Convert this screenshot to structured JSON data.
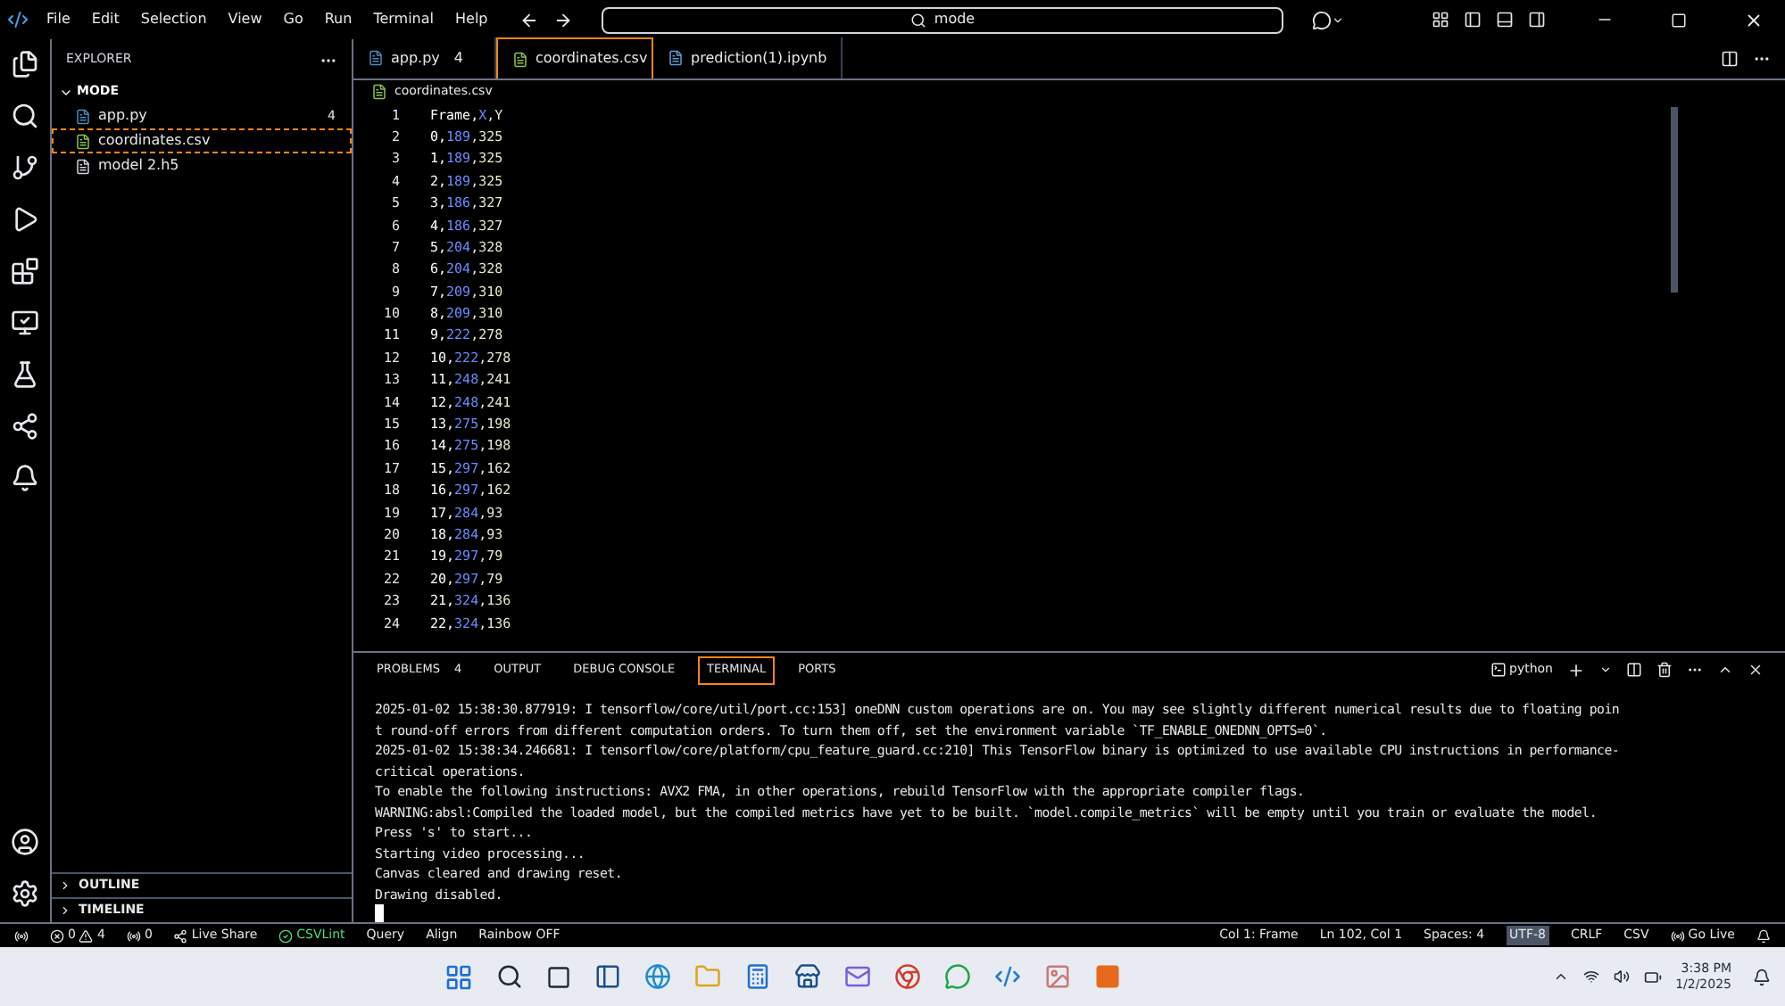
{
  "menu": [
    "File",
    "Edit",
    "Selection",
    "View",
    "Go",
    "Run",
    "Terminal",
    "Help"
  ],
  "search": {
    "value": "mode"
  },
  "sidebar": {
    "title": "EXPLORER",
    "folder": "MODE",
    "expanded": true,
    "files": [
      {
        "name": "app.py",
        "kind": "python",
        "badge": "4",
        "selected": false
      },
      {
        "name": "coordinates.csv",
        "kind": "csv",
        "selected": true
      },
      {
        "name": "model 2.h5",
        "kind": "binary",
        "selected": false
      }
    ],
    "sections": [
      {
        "label": "OUTLINE",
        "expanded": false
      },
      {
        "label": "TIMELINE",
        "expanded": false
      }
    ]
  },
  "tabs": [
    {
      "label": "app.py",
      "kind": "python",
      "badge": "4",
      "selected": false
    },
    {
      "label": "coordinates.csv",
      "kind": "csv",
      "selected": true
    },
    {
      "label": "prediction(1).ipynb",
      "kind": "notebook",
      "selected": false
    }
  ],
  "breadcrumb": "coordinates.csv",
  "editor": {
    "lines": [
      {
        "num": "1",
        "segments": [
          "Frame,",
          "X",
          ",Y"
        ]
      },
      {
        "num": "2",
        "segments": [
          "0,",
          "189",
          ",325"
        ]
      },
      {
        "num": "3",
        "segments": [
          "1,",
          "189",
          ",325"
        ]
      },
      {
        "num": "4",
        "segments": [
          "2,",
          "189",
          ",325"
        ]
      },
      {
        "num": "5",
        "segments": [
          "3,",
          "186",
          ",327"
        ]
      },
      {
        "num": "6",
        "segments": [
          "4,",
          "186",
          ",327"
        ]
      },
      {
        "num": "7",
        "segments": [
          "5,",
          "204",
          ",328"
        ]
      },
      {
        "num": "8",
        "segments": [
          "6,",
          "204",
          ",328"
        ]
      },
      {
        "num": "9",
        "segments": [
          "7,",
          "209",
          ",310"
        ]
      },
      {
        "num": "10",
        "segments": [
          "8,",
          "209",
          ",310"
        ]
      },
      {
        "num": "11",
        "segments": [
          "9,",
          "222",
          ",278"
        ]
      },
      {
        "num": "12",
        "segments": [
          "10,",
          "222",
          ",278"
        ]
      },
      {
        "num": "13",
        "segments": [
          "11,",
          "248",
          ",241"
        ]
      },
      {
        "num": "14",
        "segments": [
          "12,",
          "248",
          ",241"
        ]
      },
      {
        "num": "15",
        "segments": [
          "13,",
          "275",
          ",198"
        ]
      },
      {
        "num": "16",
        "segments": [
          "14,",
          "275",
          ",198"
        ]
      },
      {
        "num": "17",
        "segments": [
          "15,",
          "297",
          ",162"
        ]
      },
      {
        "num": "18",
        "segments": [
          "16,",
          "297",
          ",162"
        ]
      },
      {
        "num": "19",
        "segments": [
          "17,",
          "284",
          ",93"
        ]
      },
      {
        "num": "20",
        "segments": [
          "18,",
          "284",
          ",93"
        ]
      },
      {
        "num": "21",
        "segments": [
          "19,",
          "297",
          ",79"
        ]
      },
      {
        "num": "22",
        "segments": [
          "20,",
          "297",
          ",79"
        ]
      },
      {
        "num": "23",
        "segments": [
          "21,",
          "324",
          ",136"
        ]
      },
      {
        "num": "24",
        "segments": [
          "22,",
          "324",
          ",136"
        ]
      }
    ]
  },
  "panel": {
    "tabs": [
      {
        "label": "PROBLEMS",
        "badge": "4",
        "selected": false
      },
      {
        "label": "OUTPUT",
        "selected": false
      },
      {
        "label": "DEBUG CONSOLE",
        "selected": false
      },
      {
        "label": "TERMINAL",
        "selected": true
      },
      {
        "label": "PORTS",
        "selected": false
      }
    ],
    "terminal_name": "python",
    "terminal_lines": [
      "2025-01-02 15:38:30.877919: I tensorflow/core/util/port.cc:153] oneDNN custom operations are on. You may see slightly different numerical results due to floating poin",
      "t round-off errors from different computation orders. To turn them off, set the environment variable `TF_ENABLE_ONEDNN_OPTS=0`.",
      "2025-01-02 15:38:34.246681: I tensorflow/core/platform/cpu_feature_guard.cc:210] This TensorFlow binary is optimized to use available CPU instructions in performance-",
      "critical operations.",
      "To enable the following instructions: AVX2 FMA, in other operations, rebuild TensorFlow with the appropriate compiler flags.",
      "WARNING:absl:Compiled the loaded model, but the compiled metrics have yet to be built. `model.compile_metrics` will be empty until you train or evaluate the model.",
      "Press 's' to start...",
      "Starting video processing...",
      "Canvas cleared and drawing reset.",
      "Drawing disabled."
    ]
  },
  "status_bar": {
    "errors": "0",
    "warnings": "4",
    "ports": "0",
    "left": [
      "Live Share",
      "CSVLint",
      "Query",
      "Align",
      "Rainbow OFF"
    ],
    "right": [
      "Col 1: Frame",
      "Ln 102, Col 1",
      "Spaces: 4",
      "UTF-8",
      "CRLF",
      "CSV",
      "Go Live"
    ]
  },
  "taskbar": {
    "time": "3:38 PM",
    "date": "1/2/2025"
  }
}
